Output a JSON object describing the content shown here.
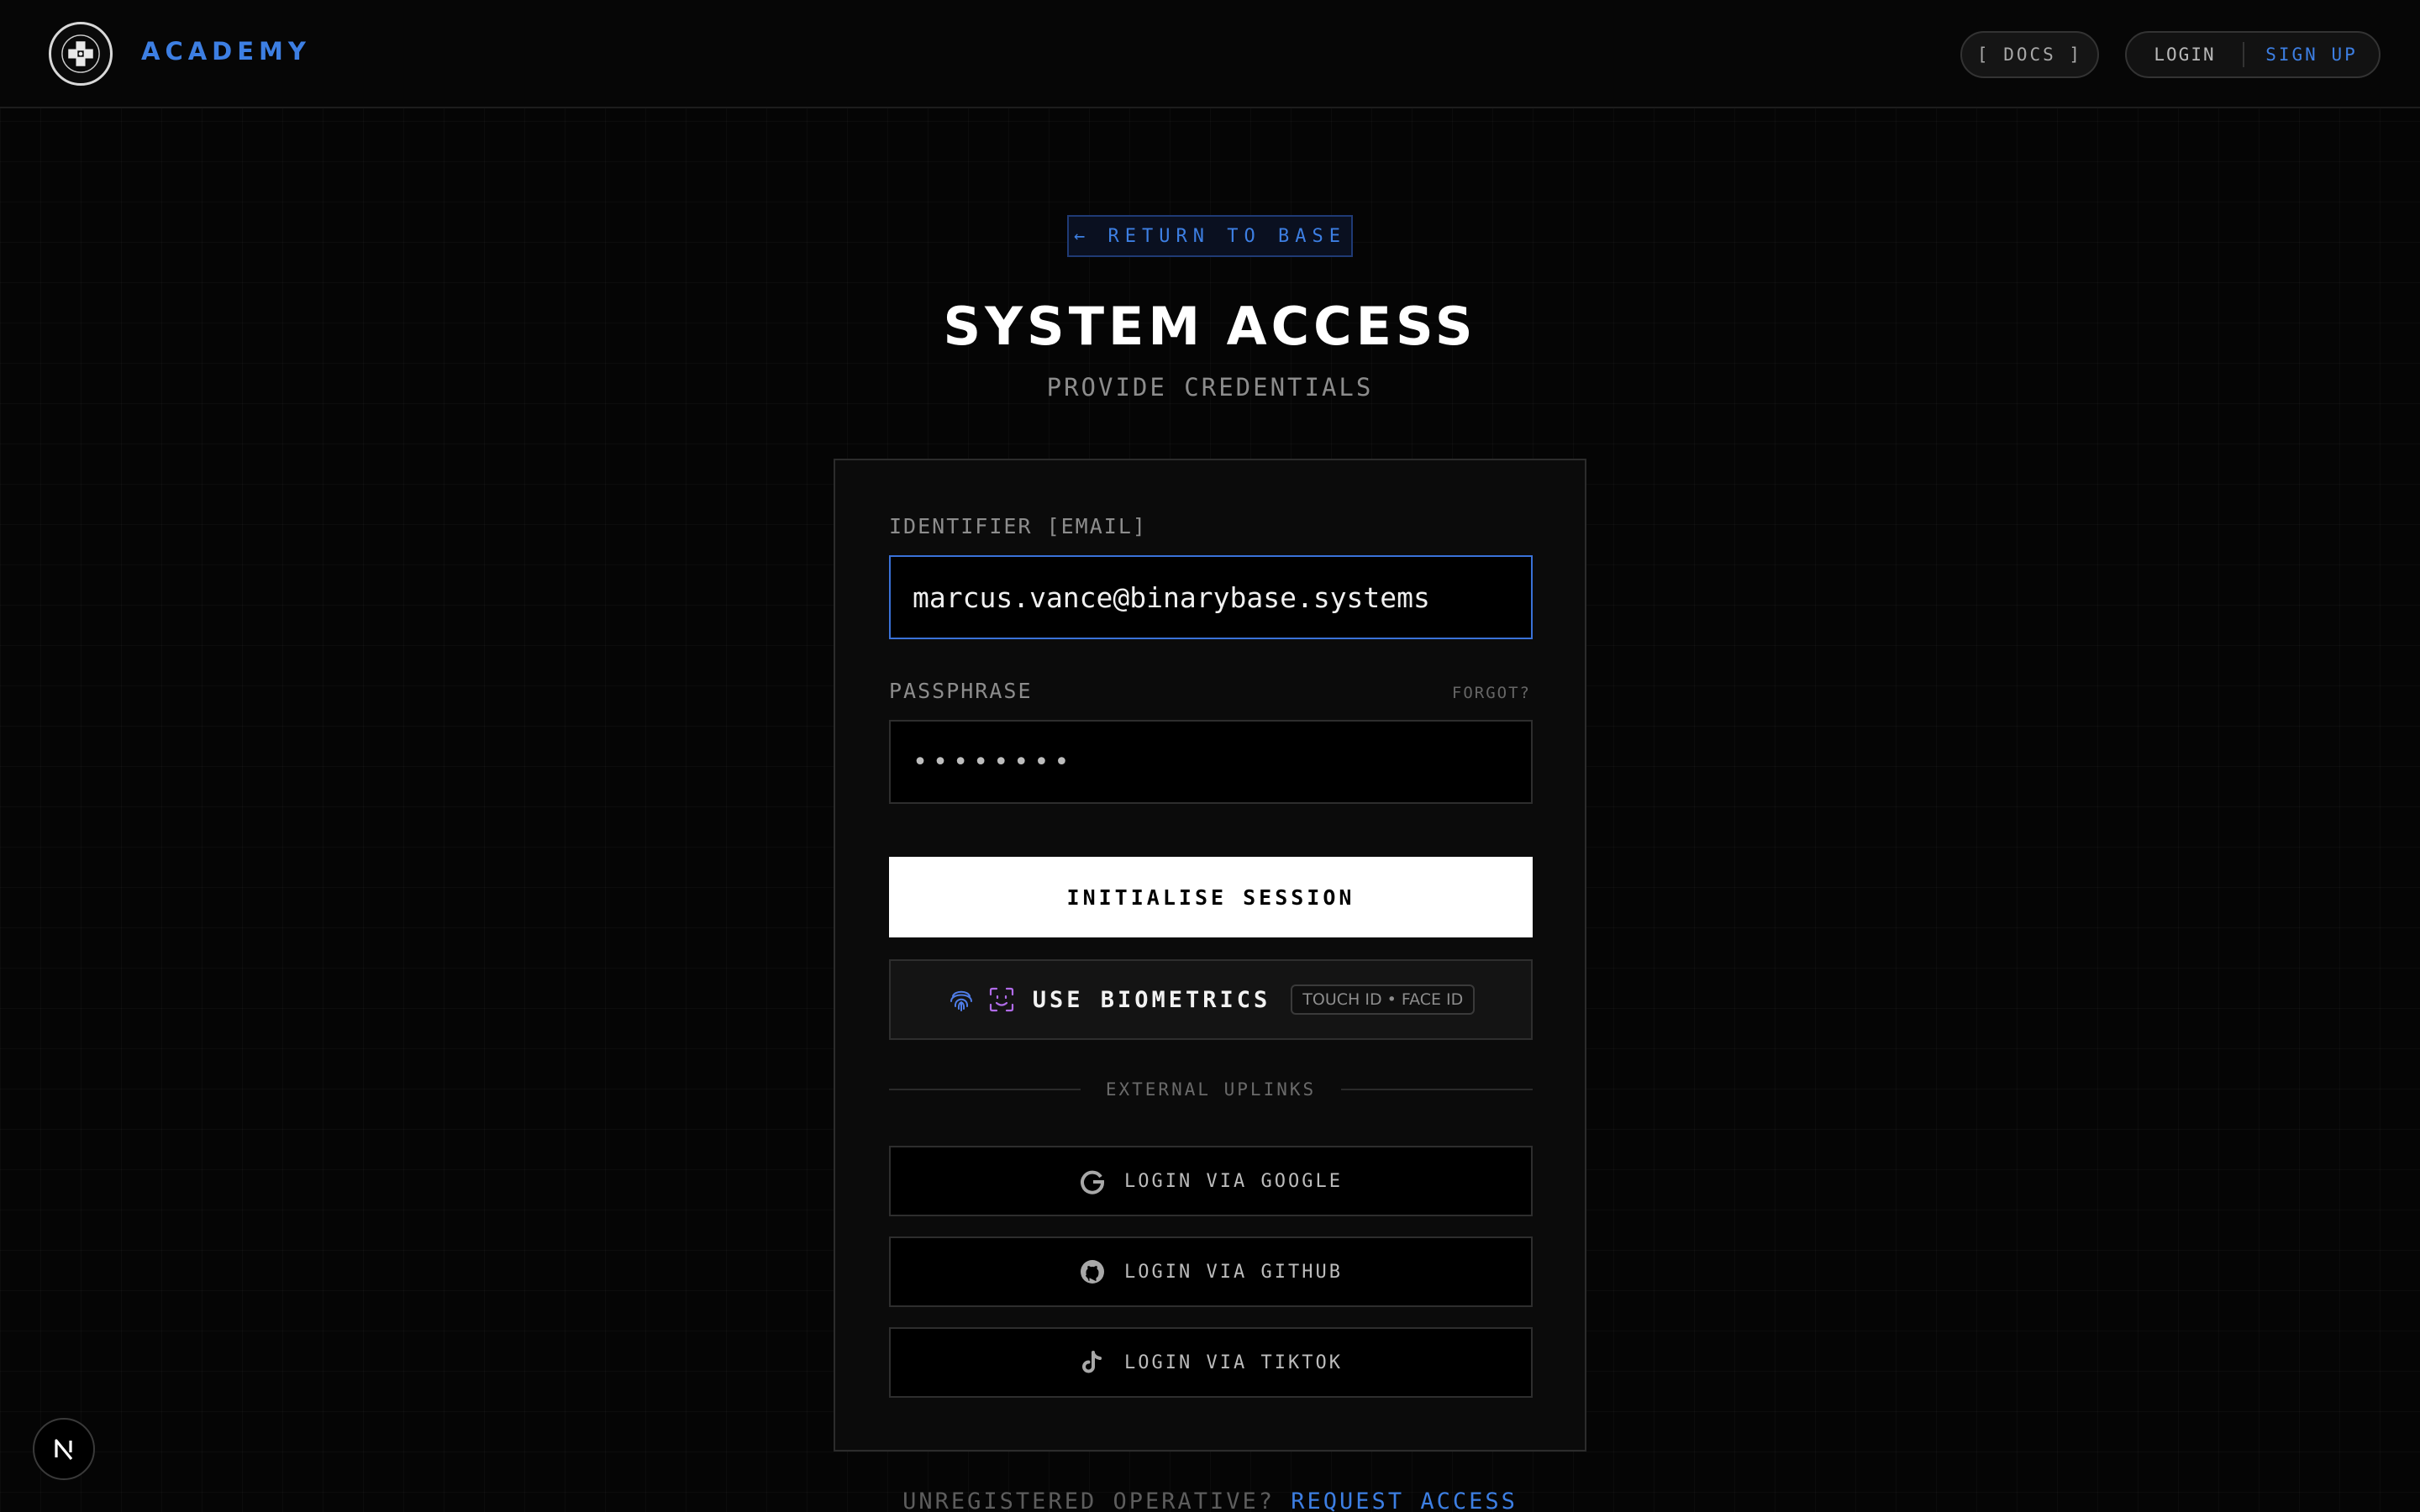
{
  "header": {
    "brand": "ACADEMY",
    "logo_icon": "binarybase-systems-logo",
    "docs_label": "[ DOCS ]",
    "login_label": "LOGIN",
    "signup_label": "SIGN UP"
  },
  "nav": {
    "return_label": "← RETURN TO BASE"
  },
  "page": {
    "title": "SYSTEM ACCESS",
    "subtitle": "PROVIDE CREDENTIALS"
  },
  "form": {
    "email_label": "IDENTIFIER [EMAIL]",
    "email_value": "marcus.vance@binarybase.systems",
    "password_label": "PASSPHRASE",
    "forgot_label": "FORGOT?",
    "password_value": "••••••••",
    "submit_label": "INITIALISE SESSION",
    "biometrics_label": "USE BIOMETRICS",
    "biometrics_badge": "TOUCH ID • FACE ID",
    "divider_label": "EXTERNAL UPLINKS",
    "social": [
      {
        "label": "LOGIN VIA GOOGLE",
        "icon": "google-icon"
      },
      {
        "label": "LOGIN VIA GITHUB",
        "icon": "github-icon"
      },
      {
        "label": "LOGIN VIA TIKTOK",
        "icon": "tiktok-icon"
      }
    ]
  },
  "footer": {
    "prompt": "UNREGISTERED OPERATIVE?",
    "link": "REQUEST ACCESS"
  },
  "colors": {
    "accent": "#3d7fe3",
    "background": "#050505",
    "focus_border": "#3a72d8",
    "primary_button": "#ffffff"
  }
}
